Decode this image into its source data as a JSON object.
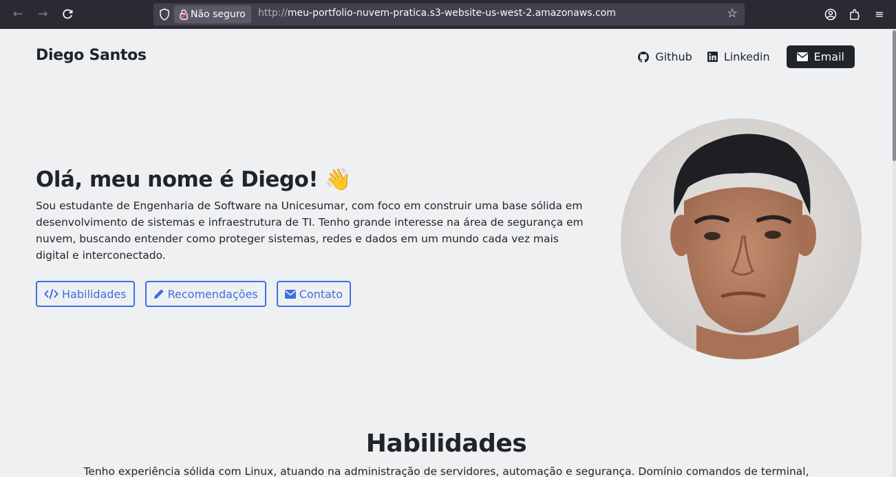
{
  "browser": {
    "security_label": "Não seguro",
    "url_prefix": "http://",
    "url_host": "meu-portfolio-nuvem-pratica.s3-website-us-west-2.amazonaws.com"
  },
  "header": {
    "brand": "Diego Santos",
    "links": [
      {
        "label": "Github",
        "icon": "github-icon"
      },
      {
        "label": "Linkedin",
        "icon": "linkedin-icon"
      },
      {
        "label": "Email",
        "icon": "envelope-icon"
      }
    ]
  },
  "hero": {
    "title": "Olá, meu nome é Diego! 👋",
    "description": "Sou estudante de Engenharia de Software na Unicesumar, com foco em construir uma base sólida em desenvolvimento de sistemas e infraestrutura de TI. Tenho grande interesse na área de segurança em nuvem, buscando entender como proteger sistemas, redes e dados em um mundo cada vez mais digital e interconectado.",
    "buttons": [
      {
        "label": "Habilidades",
        "icon": "code-icon"
      },
      {
        "label": "Recomendações",
        "icon": "pencil-icon"
      },
      {
        "label": "Contato",
        "icon": "envelope-icon"
      }
    ]
  },
  "skills": {
    "title": "Habilidades",
    "text": "Tenho experiência sólida com Linux, atuando na administração de servidores, automação e segurança. Domínio comandos de terminal,"
  },
  "colors": {
    "accent": "#3c6fe0",
    "dark": "#212529",
    "page_bg": "#eef0f2"
  }
}
